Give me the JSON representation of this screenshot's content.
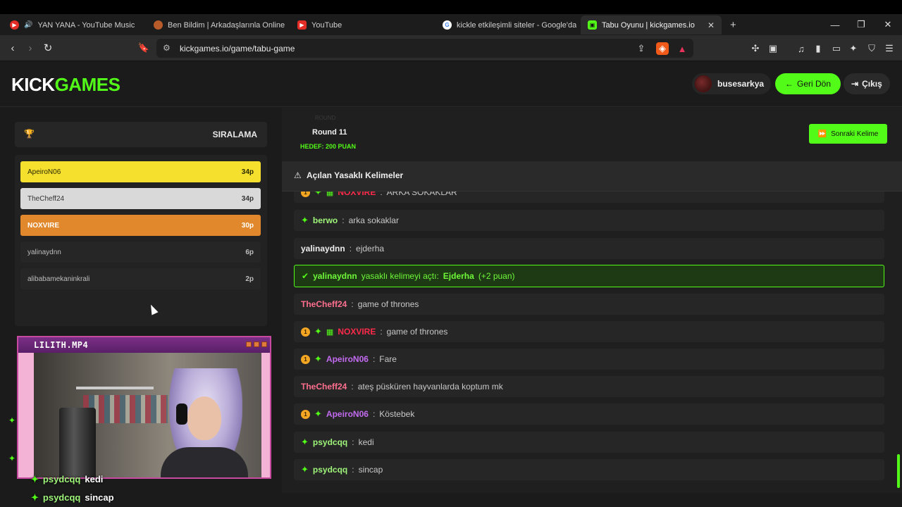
{
  "browser": {
    "tabs": [
      {
        "title": "YAN YANA - YouTube Music",
        "active": false
      },
      {
        "title": "Ben Bildim | Arkadaşlarınla Online Bil",
        "active": false
      },
      {
        "title": "YouTube",
        "active": false
      },
      {
        "title": "kickle etkileşimli siteler - Google'da A",
        "active": false
      },
      {
        "title": "Tabu Oyunu | kickgames.io",
        "active": true
      }
    ],
    "new_tab_label": "+",
    "url": "kickgames.io/game/tabu-game"
  },
  "site": {
    "logo_kick": "KICK",
    "logo_games": "GAMES",
    "username": "busesarkya",
    "back_label": "Geri Dön",
    "logout_label": "Çıkış",
    "accent": "#53fc18"
  },
  "ranking": {
    "title": "SIRALAMA",
    "players": [
      {
        "name": "ApeiroN06",
        "points": "34p"
      },
      {
        "name": "TheCheff24",
        "points": "34p"
      },
      {
        "name": "NOXVIRE",
        "points": "30p"
      },
      {
        "name": "yalinaydnn",
        "points": "6p"
      },
      {
        "name": "alibabamekaninkrali",
        "points": "2p"
      }
    ]
  },
  "stream": {
    "name": "LILITH.MP4",
    "overlay_chat": [
      {
        "user": "psydcqq",
        "text": "kedi"
      },
      {
        "user": "psydcqq",
        "text": "sincap"
      }
    ]
  },
  "game": {
    "round_faint": "ROUND",
    "round_label": "Round 11",
    "target_label": "HEDEF: 200 PUAN",
    "next_label": "Sonraki Kelime",
    "banned_title": "Açılan Yasaklı Kelimeler",
    "messages": [
      {
        "badge": "1",
        "spark": true,
        "gift": true,
        "user": "NOXVIRE",
        "text": "ARKA SOKAKLAR",
        "color": "red"
      },
      {
        "badge": "",
        "spark": true,
        "gift": false,
        "user": "berwo",
        "text": "arka sokaklar",
        "color": "green"
      },
      {
        "badge": "",
        "spark": false,
        "gift": false,
        "user": "yalinaydnn",
        "text": "ejderha",
        "color": "white"
      },
      {
        "system": true,
        "user": "yalinaydnn",
        "middle": "yasaklı kelimeyi açtı:",
        "word": "Ejderha",
        "bonus": "(+2 puan)"
      },
      {
        "badge": "",
        "spark": false,
        "gift": false,
        "user": "TheCheff24",
        "text": "game of thrones",
        "color": "pink"
      },
      {
        "badge": "1",
        "spark": true,
        "gift": true,
        "user": "NOXVIRE",
        "text": "game of thrones",
        "color": "red"
      },
      {
        "badge": "1",
        "spark": true,
        "gift": false,
        "user": "ApeiroN06",
        "text": "Fare",
        "color": "purple"
      },
      {
        "badge": "",
        "spark": false,
        "gift": false,
        "user": "TheCheff24",
        "text": "ateş püsküren hayvanlarda koptum mk",
        "color": "pink"
      },
      {
        "badge": "1",
        "spark": true,
        "gift": false,
        "user": "ApeiroN06",
        "text": "Köstebek",
        "color": "purple"
      },
      {
        "badge": "",
        "spark": true,
        "gift": false,
        "user": "psydcqq",
        "text": "kedi",
        "color": "green"
      },
      {
        "badge": "",
        "spark": true,
        "gift": false,
        "user": "psydcqq",
        "text": "sincap",
        "color": "green"
      }
    ]
  }
}
